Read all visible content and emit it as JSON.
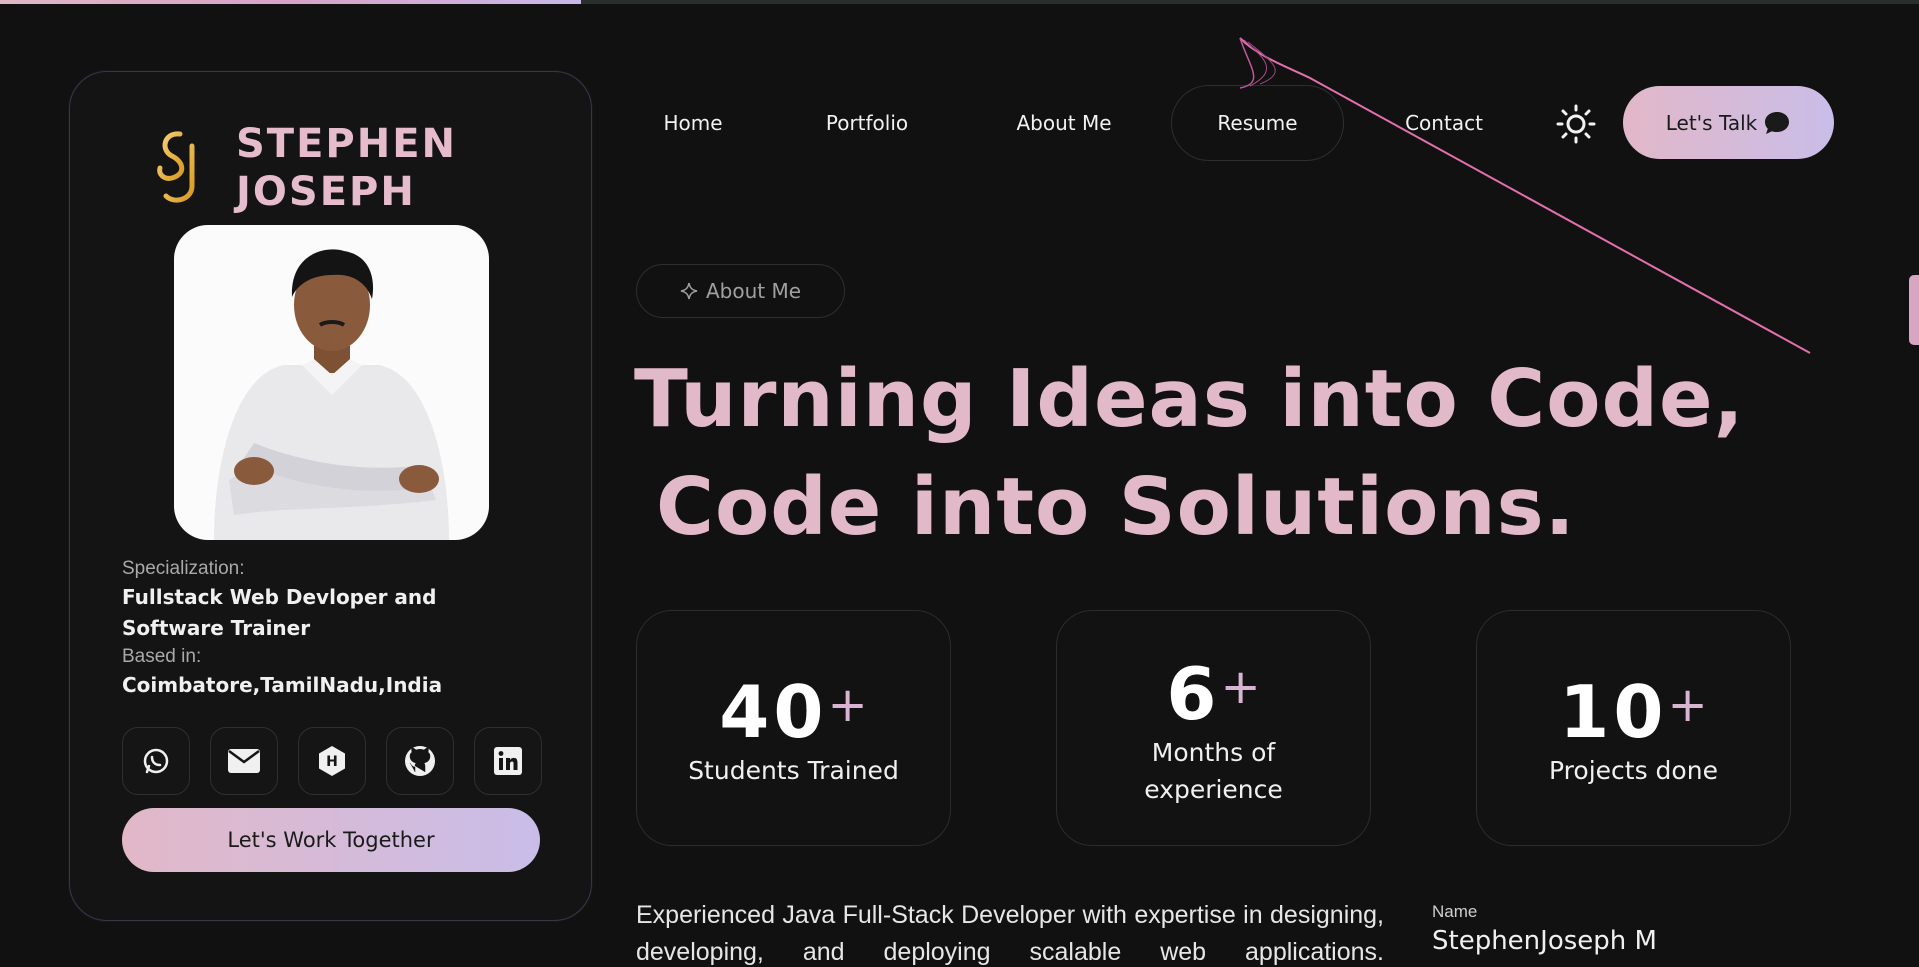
{
  "scroll_progress": 0.303,
  "brand": {
    "first": "STEPHEN",
    "last": "JOSEPH",
    "logo_icon": "sj-monogram-logo",
    "accent": "#e6bccd"
  },
  "profile": {
    "specialization_label": "Specialization:",
    "specialization_value": "Fullstack Web Devloper and Software Trainer",
    "based_label": "Based in:",
    "based_value": "Coimbatore,TamilNadu,India",
    "socials": [
      "whatsapp-icon",
      "mail-icon",
      "hashnode-icon",
      "github-icon",
      "linkedin-icon"
    ],
    "cta": "Let's Work Together"
  },
  "nav": {
    "items": [
      {
        "label": "Home",
        "active": false
      },
      {
        "label": "Portfolio",
        "active": false
      },
      {
        "label": "About Me",
        "active": false
      },
      {
        "label": "Resume",
        "active": true
      },
      {
        "label": "Contact",
        "active": false
      }
    ],
    "theme_icon": "sun-icon",
    "talk_label": "Let's Talk",
    "talk_icon": "chat-bubble-icon"
  },
  "about": {
    "badge_icon": "sparkle-icon",
    "badge": "About Me",
    "headline_line1": "Turning Ideas into Code,",
    "headline_line2": "Code into Solutions."
  },
  "stats": [
    {
      "number": "40",
      "suffix": "+",
      "label": "Students Trained"
    },
    {
      "number": "6",
      "suffix": "+",
      "label": "Months of experience"
    },
    {
      "number": "10",
      "suffix": "+",
      "label": "Projects done"
    }
  ],
  "description": "Experienced Java Full-Stack Developer with expertise in designing, developing, and deploying scalable web applications.",
  "details": {
    "name_label": "Name",
    "name_value": "StephenJoseph M"
  },
  "colors": {
    "background": "#111111",
    "accent_pink": "#e2b9c9",
    "accent_lavender": "#c9bde8"
  }
}
